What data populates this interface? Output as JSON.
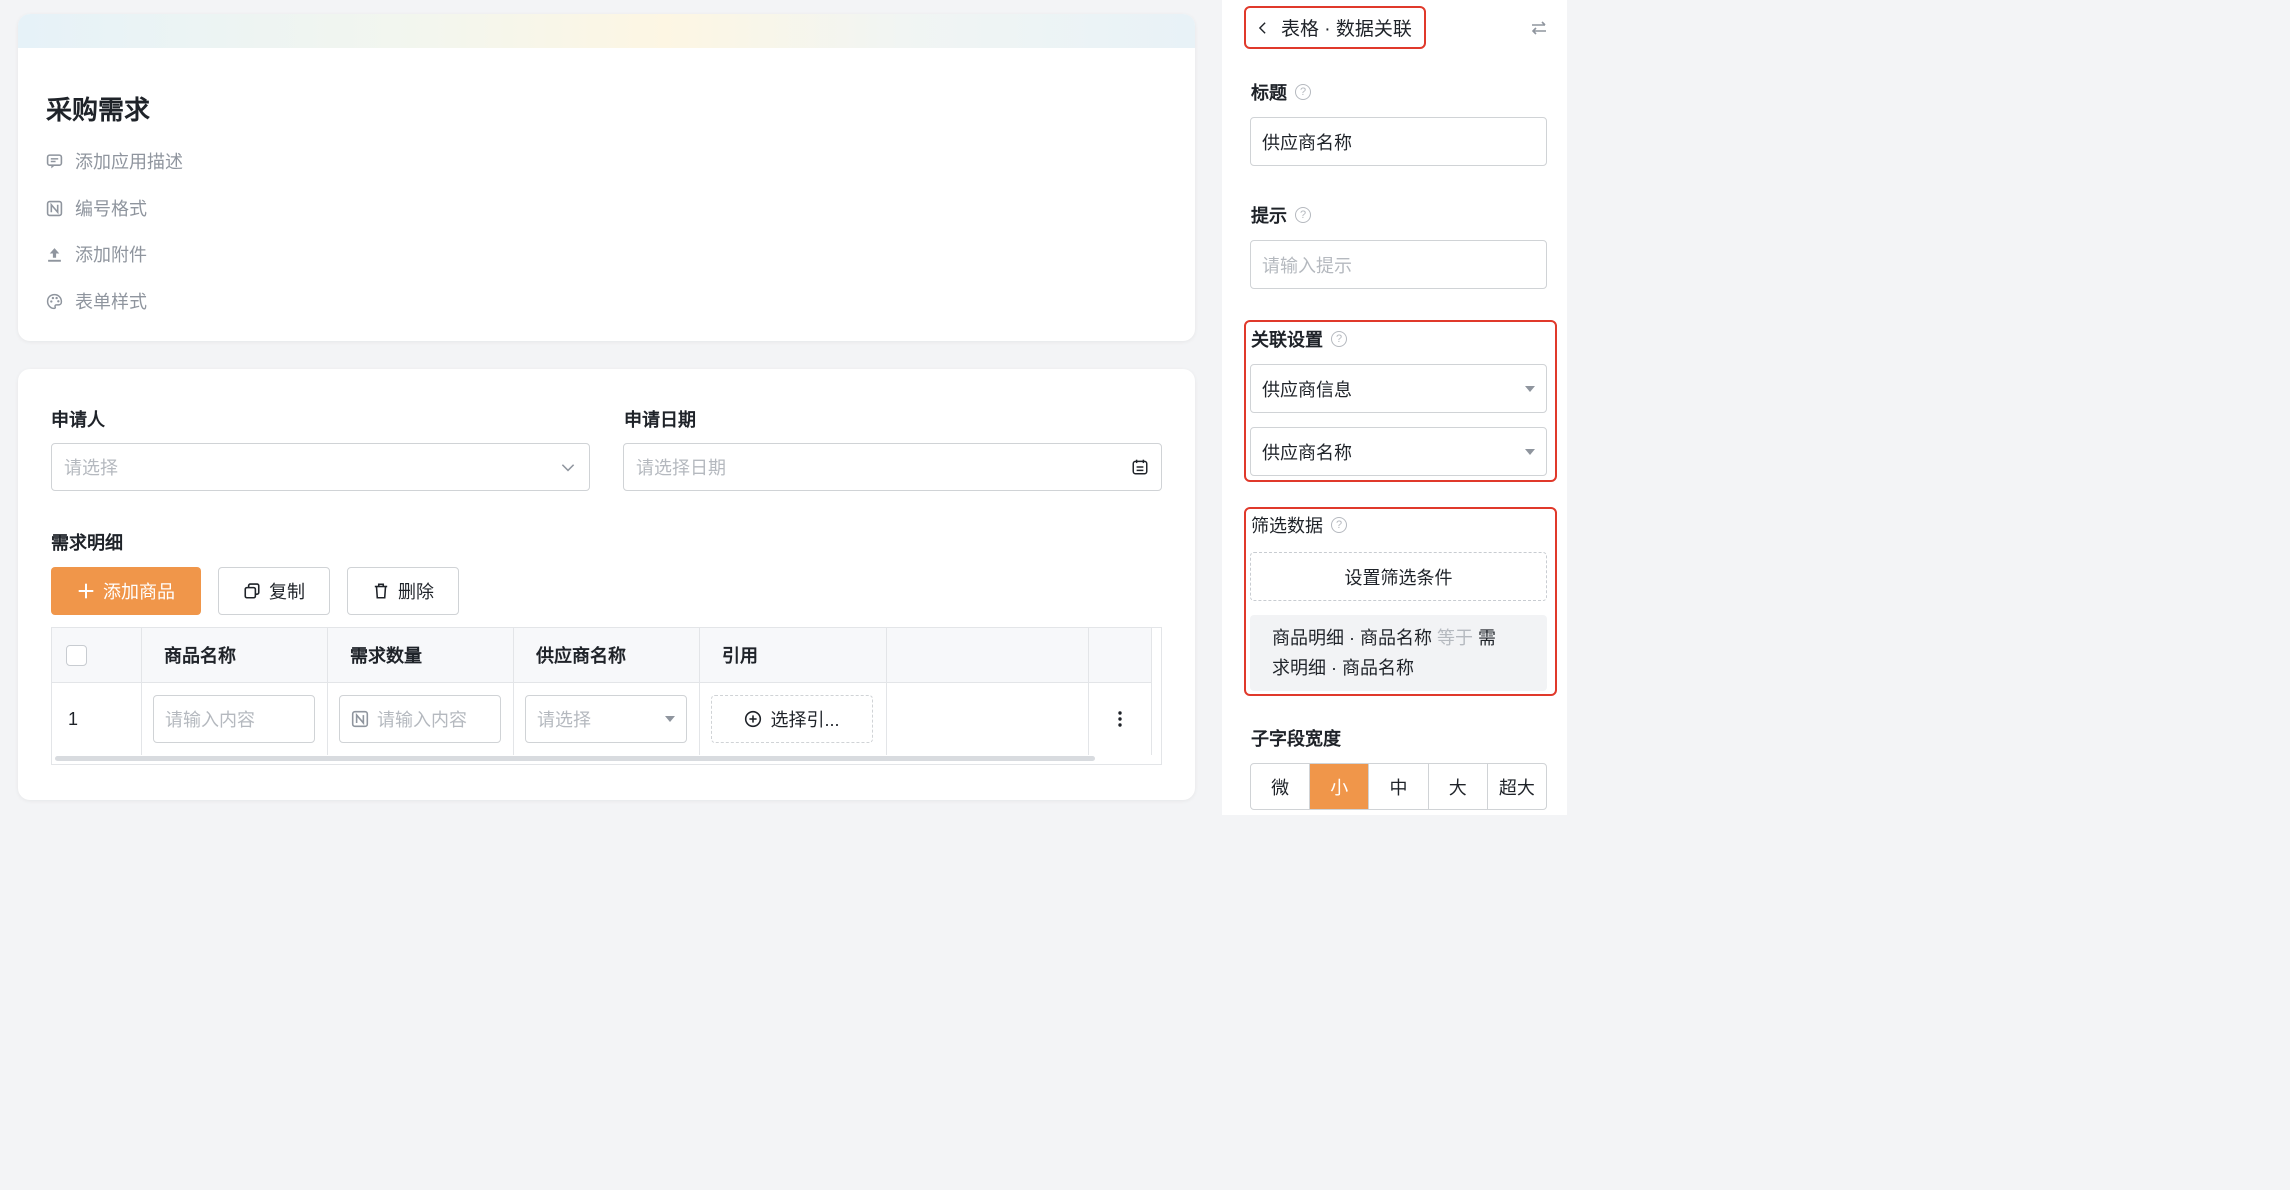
{
  "header_card": {
    "title": "采购需求",
    "meta": [
      {
        "label": "添加应用描述",
        "icon": "comment-icon"
      },
      {
        "label": "编号格式",
        "icon": "number-format-icon"
      },
      {
        "label": "添加附件",
        "icon": "upload-icon"
      },
      {
        "label": "表单样式",
        "icon": "palette-icon"
      }
    ]
  },
  "form": {
    "applicant": {
      "label": "申请人",
      "placeholder": "请选择"
    },
    "apply_date": {
      "label": "申请日期",
      "placeholder": "请选择日期"
    },
    "detail": {
      "label": "需求明细",
      "buttons": {
        "add": "添加商品",
        "copy": "复制",
        "delete": "删除"
      },
      "columns": [
        "商品名称",
        "需求数量",
        "供应商名称",
        "引用"
      ],
      "rows": [
        {
          "index": "1",
          "name_placeholder": "请输入内容",
          "qty_placeholder": "请输入内容",
          "supplier_placeholder": "请选择",
          "ref_label": "选择引..."
        }
      ]
    }
  },
  "panel": {
    "header": "表格 · 数据关联",
    "title_field": {
      "label": "标题",
      "value": "供应商名称"
    },
    "hint_field": {
      "label": "提示",
      "placeholder": "请输入提示"
    },
    "relation": {
      "label": "关联设置",
      "source": "供应商信息",
      "field": "供应商名称"
    },
    "filter": {
      "label": "筛选数据",
      "button": "设置筛选条件",
      "cond_left": "商品明细 · 商品名称",
      "cond_op": "等于",
      "cond_right_1": "需",
      "cond_right_2": "求明细 · 商品名称"
    },
    "width": {
      "label": "子字段宽度",
      "options": [
        "微",
        "小",
        "中",
        "大",
        "超大"
      ],
      "selected": "小"
    }
  },
  "colors": {
    "accent": "#f0964a",
    "highlight": "#e0392b"
  }
}
